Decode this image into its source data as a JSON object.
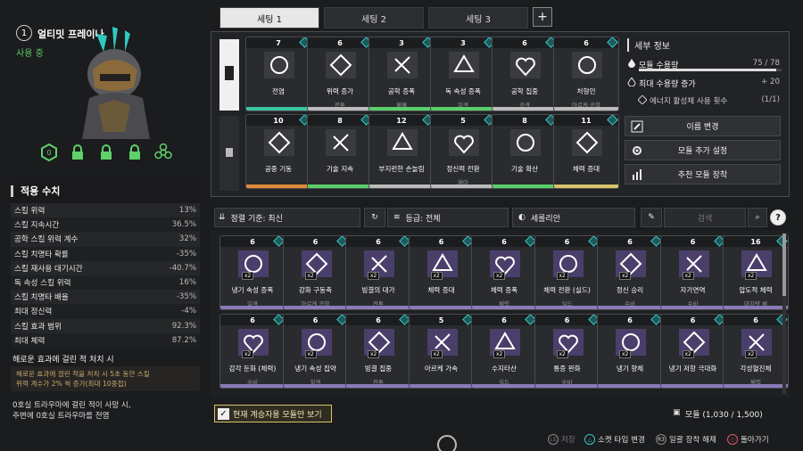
{
  "character": {
    "num": "1",
    "name": "얼티밋 프레이나",
    "status": "사용 중"
  },
  "stats": {
    "title": "적용 수치",
    "rows": [
      {
        "label": "스킬 위력",
        "value": "13%"
      },
      {
        "label": "스킬 지속시간",
        "value": "36.5%"
      },
      {
        "label": "공학 스킬 위력 계수",
        "value": "32%"
      },
      {
        "label": "스킬 치명타 확률",
        "value": "-35%"
      },
      {
        "label": "스킬 재사용 대기시간",
        "value": "-40.7%"
      },
      {
        "label": "독 속성 스킬 위력",
        "value": "16%"
      },
      {
        "label": "스킬 치명타 배율",
        "value": "-35%"
      },
      {
        "label": "최대 정신력",
        "value": "-4%"
      },
      {
        "label": "스킬 효과 범위",
        "value": "92.3%"
      },
      {
        "label": "최대 체력",
        "value": "87.2%"
      }
    ]
  },
  "bonus": {
    "title": "해로운 효과에 걸린 적 처치 시",
    "line1": "해로운 효과에 걸린 적을 처치 시 5초 동안 스킬",
    "line2": "위력 계수가 2% 씩 증가(최대 10중첩)",
    "line3": "0호실 트라우마에 걸린 적이 사망 시,",
    "line4": "주변에 0호실 트라우마를 전염"
  },
  "tabs": [
    "세팅 1",
    "세팅 2",
    "세팅 3"
  ],
  "tab_add": "+",
  "equipped": [
    {
      "cost": "7",
      "name": "전염",
      "sub": "",
      "color": "#3bc4a0"
    },
    {
      "cost": "6",
      "name": "위력 증가",
      "sub": "전투",
      "color": "#bbb"
    },
    {
      "cost": "3",
      "name": "공학 증폭",
      "sub": "웰웰",
      "color": "#5ad06a"
    },
    {
      "cost": "3",
      "name": "독 속성 증폭",
      "sub": "일격",
      "color": "#5ad06a"
    },
    {
      "cost": "6",
      "name": "공학 집중",
      "sub": "공격",
      "color": "#bbb"
    },
    {
      "cost": "6",
      "name": "처형인",
      "sub": "아르케 공학",
      "color": "#bbb"
    },
    {
      "cost": "10",
      "name": "공중 기동",
      "sub": "",
      "color": "#e08a3a"
    },
    {
      "cost": "8",
      "name": "기술 지속",
      "sub": "",
      "color": "#5ad06a"
    },
    {
      "cost": "12",
      "name": "부지런한 손놀림",
      "sub": "",
      "color": "#bbb"
    },
    {
      "cost": "5",
      "name": "정신력 전환",
      "sub": "제어",
      "color": "#bbb"
    },
    {
      "cost": "8",
      "name": "기술 확산",
      "sub": "",
      "color": "#5ad06a"
    },
    {
      "cost": "11",
      "name": "체력 증대",
      "sub": "",
      "color": "#d8c36a"
    }
  ],
  "detail": {
    "title": "세부 정보",
    "cap_label": "모듈 수용량",
    "cap_value": "75 / 78",
    "capacity_ratio": 0.96,
    "maxcap_label": "최대 수용량 증가",
    "maxcap_value": "+ 20",
    "energy_label": "에너지 활성체 사용 횟수",
    "energy_value": "(1/1)",
    "buttons": [
      "이름 변경",
      "모듈 추가 설정",
      "추천 모듈 장착"
    ]
  },
  "filters": {
    "sort": "정렬 기준: 최신",
    "grade": "등급: 전체",
    "socket": "세룰리안",
    "search_placeholder": "검색",
    "help": "?"
  },
  "inventory": [
    {
      "cost": "6",
      "name": "냉기 속성 증폭",
      "sub": "일격"
    },
    {
      "cost": "6",
      "name": "강화 구동축",
      "sub": "아르케 공학"
    },
    {
      "cost": "6",
      "name": "빙결의 대가",
      "sub": "전투"
    },
    {
      "cost": "6",
      "name": "체력 증대",
      "sub": ""
    },
    {
      "cost": "6",
      "name": "체력 증폭",
      "sub": "체력"
    },
    {
      "cost": "6",
      "name": "체력 전환 (실드)",
      "sub": "실드"
    },
    {
      "cost": "6",
      "name": "정신 승리",
      "sub": "수비"
    },
    {
      "cost": "6",
      "name": "자가면역",
      "sub": "수비"
    },
    {
      "cost": "16",
      "name": "압도적 체력",
      "sub": "마지막 체"
    },
    {
      "cost": "6",
      "name": "감각 둔화 (체력)",
      "sub": "수비"
    },
    {
      "cost": "6",
      "name": "냉기 속성 집약",
      "sub": "일격"
    },
    {
      "cost": "6",
      "name": "빙결 집중",
      "sub": "전투"
    },
    {
      "cost": "5",
      "name": "아르케 가속",
      "sub": ""
    },
    {
      "cost": "6",
      "name": "수지타산",
      "sub": "실드"
    },
    {
      "cost": "6",
      "name": "통증 완화",
      "sub": "수비"
    },
    {
      "cost": "6",
      "name": "냉기 향체",
      "sub": ""
    },
    {
      "cost": "6",
      "name": "냉기 저항 극대화",
      "sub": ""
    },
    {
      "cost": "6",
      "name": "각성혈진체",
      "sub": "체력"
    }
  ],
  "show_equip_label": "현재 계승자용 모듈만 보기",
  "module_count": "모듈 (1,030 / 1,500)",
  "footer": {
    "save": "저장",
    "socket": "소켓 타입 변경",
    "unequip": "일괄 장착 해제",
    "back": "돌아가기"
  },
  "colors": {
    "accent_green": "#5fd06a",
    "socket_cyan": "#3bc4c4",
    "gold": "#d8c36a"
  }
}
